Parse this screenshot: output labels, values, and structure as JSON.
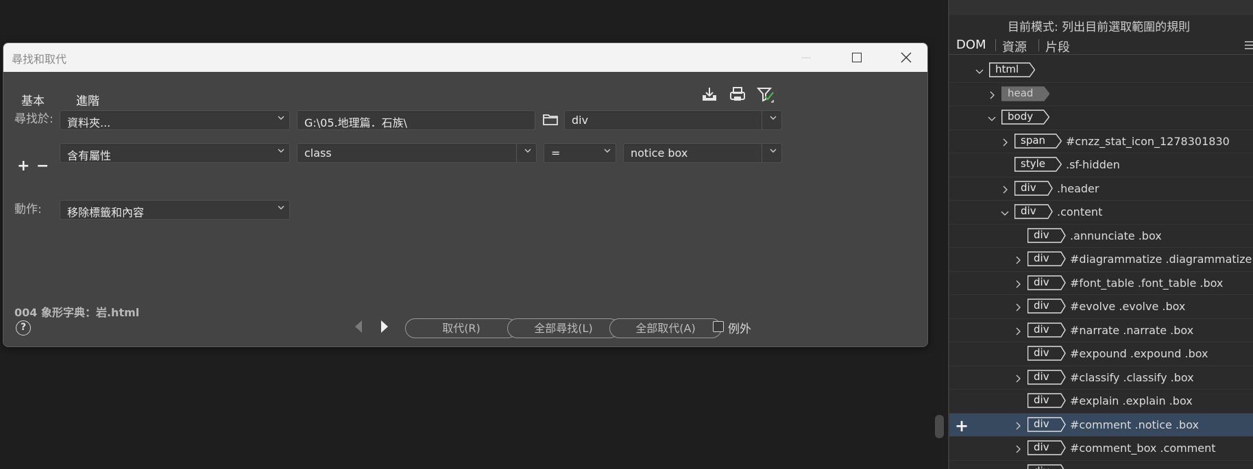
{
  "dialog": {
    "title": "尋找和取代",
    "tabs": [
      "基本",
      "進階"
    ],
    "active_tab": "進階",
    "search_in_label": "尋找於:",
    "search_in_value": "資料夾...",
    "path_value": "G:\\05.地理篇．石族\\",
    "tag_value": "div",
    "condition_value": "含有屬性",
    "attr_name_value": "class",
    "operator_value": "=",
    "attr_value": "notice box",
    "action_label": "動作:",
    "action_value": "移除標籤和內容",
    "current_file": "004 象形字典：岩.html",
    "help_glyph": "?",
    "buttons": {
      "replace": "取代(R)",
      "find_all": "全部尋找(L)",
      "replace_all": "全部取代(A)"
    },
    "exception_label": "例外",
    "plus": "+",
    "minus": "−"
  },
  "panel": {
    "mode_text": "目前模式: 列出目前選取範圍的規則",
    "tabs": [
      "DOM",
      "資源",
      "片段"
    ],
    "active_tab": "DOM",
    "tree": [
      {
        "tag": "html",
        "selector": "",
        "indent": 0,
        "toggle": "open"
      },
      {
        "tag": "head",
        "selector": "",
        "indent": 1,
        "toggle": "closed",
        "grey": true
      },
      {
        "tag": "body",
        "selector": "",
        "indent": 1,
        "toggle": "open"
      },
      {
        "tag": "span",
        "selector": "#cnzz_stat_icon_1278301830",
        "indent": 2,
        "toggle": "closed"
      },
      {
        "tag": "style",
        "selector": ".sf-hidden",
        "indent": 2,
        "toggle": "none"
      },
      {
        "tag": "div",
        "selector": ".header",
        "indent": 2,
        "toggle": "closed"
      },
      {
        "tag": "div",
        "selector": ".content",
        "indent": 2,
        "toggle": "open"
      },
      {
        "tag": "div",
        "selector": ".annunciate .box",
        "indent": 3,
        "toggle": "none"
      },
      {
        "tag": "div",
        "selector": "#diagrammatize .diagrammatize .clea",
        "indent": 3,
        "toggle": "closed"
      },
      {
        "tag": "div",
        "selector": "#font_table .font_table .box",
        "indent": 3,
        "toggle": "closed"
      },
      {
        "tag": "div",
        "selector": "#evolve .evolve .box",
        "indent": 3,
        "toggle": "closed"
      },
      {
        "tag": "div",
        "selector": "#narrate .narrate .box",
        "indent": 3,
        "toggle": "closed"
      },
      {
        "tag": "div",
        "selector": "#expound .expound .box",
        "indent": 3,
        "toggle": "none"
      },
      {
        "tag": "div",
        "selector": "#classify .classify .box",
        "indent": 3,
        "toggle": "closed"
      },
      {
        "tag": "div",
        "selector": "#explain .explain .box",
        "indent": 3,
        "toggle": "none"
      },
      {
        "tag": "div",
        "selector": "#comment .notice .box",
        "indent": 3,
        "toggle": "closed",
        "selected": true
      },
      {
        "tag": "div",
        "selector": "#comment_box .comment",
        "indent": 3,
        "toggle": "closed"
      },
      {
        "tag": "div",
        "selector": "",
        "indent": 3,
        "toggle": "closed"
      }
    ]
  }
}
